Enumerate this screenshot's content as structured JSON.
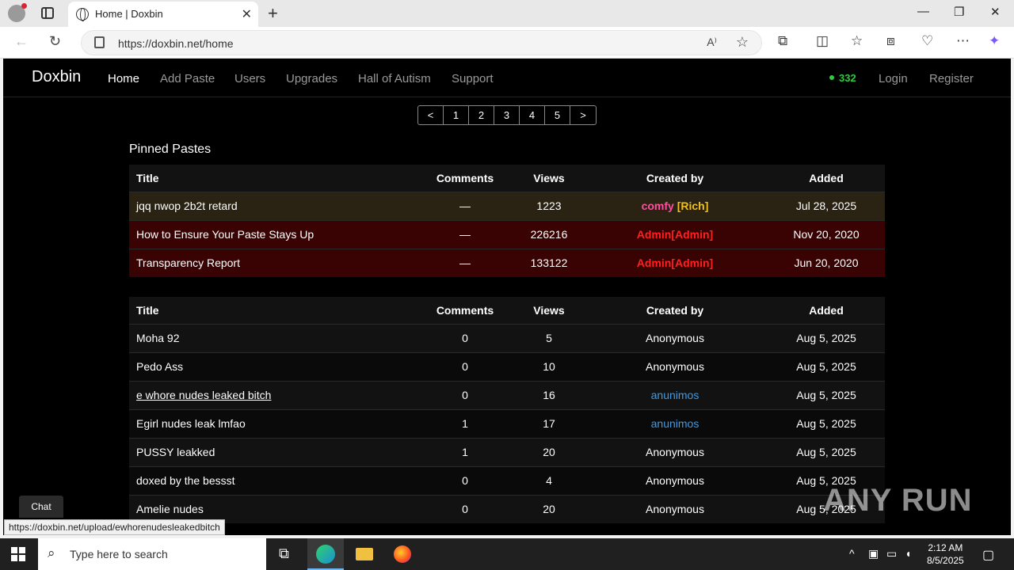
{
  "browser": {
    "tab_title": "Home | Doxbin",
    "url": "https://doxbin.net/home",
    "status_url": "https://doxbin.net/upload/ewhorenudesleakedbitch"
  },
  "nav": {
    "brand": "Doxbin",
    "links": [
      "Home",
      "Add Paste",
      "Users",
      "Upgrades",
      "Hall of Autism",
      "Support"
    ],
    "online_count": "332",
    "login": "Login",
    "register": "Register"
  },
  "pager": [
    "<",
    "1",
    "2",
    "3",
    "4",
    "5",
    ">"
  ],
  "pinned": {
    "title": "Pinned Pastes",
    "headers": [
      "Title",
      "Comments",
      "Views",
      "Created by",
      "Added"
    ],
    "rows": [
      {
        "title": "jqq nwop 2b2t retard",
        "comments": "—",
        "views": "1223",
        "by_name": "comfy",
        "by_tag": "[Rich]",
        "added": "Jul 28, 2025"
      },
      {
        "title": "How to Ensure Your Paste Stays Up",
        "comments": "—",
        "views": "226216",
        "by_name": "Admin",
        "by_tag": "[Admin]",
        "added": "Nov 20, 2020"
      },
      {
        "title": "Transparency Report",
        "comments": "—",
        "views": "133122",
        "by_name": "Admin",
        "by_tag": "[Admin]",
        "added": "Jun 20, 2020"
      }
    ]
  },
  "pastes": {
    "headers": [
      "Title",
      "Comments",
      "Views",
      "Created by",
      "Added"
    ],
    "rows": [
      {
        "title": "Moha 92",
        "comments": "0",
        "views": "5",
        "by": "Anonymous",
        "added": "Aug 5, 2025"
      },
      {
        "title": "Pedo Ass",
        "comments": "0",
        "views": "10",
        "by": "Anonymous",
        "added": "Aug 5, 2025"
      },
      {
        "title": "e whore nudes leaked bitch",
        "comments": "0",
        "views": "16",
        "by": "anunimos",
        "added": "Aug 5, 2025"
      },
      {
        "title": "Egirl nudes leak lmfao",
        "comments": "1",
        "views": "17",
        "by": "anunimos",
        "added": "Aug 5, 2025"
      },
      {
        "title": "PUSSY leakked",
        "comments": "1",
        "views": "20",
        "by": "Anonymous",
        "added": "Aug 5, 2025"
      },
      {
        "title": "doxed by the bessst",
        "comments": "0",
        "views": "4",
        "by": "Anonymous",
        "added": "Aug 5, 2025"
      },
      {
        "title": "Amelie nudes",
        "comments": "0",
        "views": "20",
        "by": "Anonymous",
        "added": "Aug 5, 2025"
      }
    ]
  },
  "chat_label": "Chat",
  "watermark": "ANY RUN",
  "taskbar": {
    "search_placeholder": "Type here to search",
    "time": "2:12 AM",
    "date": "8/5/2025"
  }
}
